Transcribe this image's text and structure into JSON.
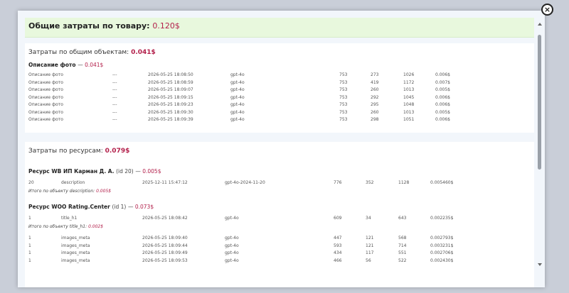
{
  "modal": {
    "close_glyph": "×",
    "total": {
      "label": "Общие затраты по товару:",
      "value": "0.120$"
    },
    "common": {
      "label": "Затраты по общим объектам:",
      "value": "0.041$",
      "groups": [
        {
          "title": "Описание фото",
          "cost": "0.041$",
          "rows": [
            [
              "Описание фото",
              "---",
              "2026-05-25 18:08:50",
              "gpt-4o",
              "753",
              "273",
              "1026",
              "0.006$"
            ],
            [
              "Описание фото",
              "---",
              "2026-05-25 18:08:59",
              "gpt-4o",
              "753",
              "419",
              "1172",
              "0.007$"
            ],
            [
              "Описание фото",
              "---",
              "2026-05-25 18:09:07",
              "gpt-4o",
              "753",
              "260",
              "1013",
              "0.005$"
            ],
            [
              "Описание фото",
              "---",
              "2026-05-25 18:09:15",
              "gpt-4o",
              "753",
              "292",
              "1045",
              "0.006$"
            ],
            [
              "Описание фото",
              "---",
              "2026-05-25 18:09:23",
              "gpt-4o",
              "753",
              "295",
              "1048",
              "0.006$"
            ],
            [
              "Описание фото",
              "---",
              "2026-05-25 18:09:30",
              "gpt-4o",
              "753",
              "260",
              "1013",
              "0.005$"
            ],
            [
              "Описание фото",
              "---",
              "2026-05-25 18:09:39",
              "gpt-4o",
              "753",
              "298",
              "1051",
              "0.006$"
            ]
          ]
        }
      ]
    },
    "resources": {
      "label": "Затраты по ресурсам:",
      "value": "0.079$",
      "groups": [
        {
          "title": "Ресурс WB ИП Карман Д. А.",
          "id_text": "(id 20)",
          "cost": "0.005$",
          "rows": [
            [
              "20",
              "description",
              "2025-12-11 15:47:12",
              "gpt-4o-2024-11-20",
              "776",
              "352",
              "1128",
              "0.005460$"
            ]
          ],
          "subtotal_label": "Итого по объекту description:",
          "subtotal_value": "0.005$"
        },
        {
          "title": "Ресурс WOO Rating.Center",
          "id_text": "(id 1)",
          "cost": "0.073$",
          "rows": [
            [
              "1",
              "title_h1",
              "2026-05-25 18:08:42",
              "gpt-4o",
              "609",
              "34",
              "643",
              "0.002235$"
            ]
          ],
          "subtotal_label": "Итого по объекту title_h1:",
          "subtotal_value": "0.002$",
          "rows2": [
            [
              "1",
              "images_meta",
              "2026-05-25 18:09:40",
              "gpt-4o",
              "447",
              "121",
              "568",
              "0.002793$"
            ],
            [
              "1",
              "images_meta",
              "2026-05-25 18:09:44",
              "gpt-4o",
              "593",
              "121",
              "714",
              "0.003231$"
            ],
            [
              "1",
              "images_meta",
              "2026-05-25 18:09:49",
              "gpt-4o",
              "434",
              "117",
              "551",
              "0.002706$"
            ],
            [
              "1",
              "images_meta",
              "2026-05-25 18:09:53",
              "gpt-4o",
              "466",
              "56",
              "522",
              "0.002430$"
            ]
          ]
        }
      ]
    }
  }
}
